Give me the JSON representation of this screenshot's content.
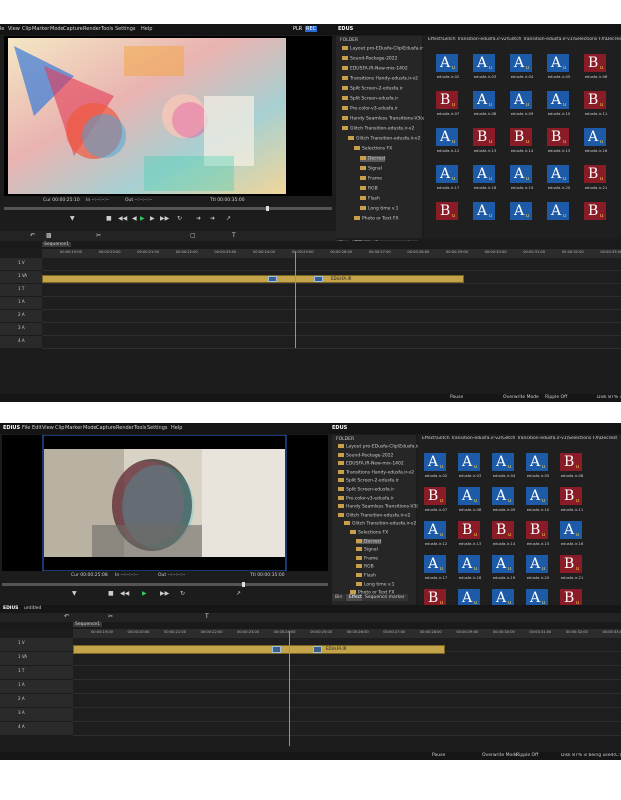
{
  "menu": [
    "File",
    "Edit",
    "View",
    "Clip",
    "Marker",
    "Mode",
    "Capture",
    "Render",
    "Tools",
    "Settings",
    "Help"
  ],
  "app_badge": "EDUS",
  "plr_label": "PLR",
  "rec_label": "REC",
  "monitor": {
    "cur": "Cur 00:00:25:10",
    "in": "In --:--:--:--",
    "out": "Out --:--:--:--",
    "ttl": "Ttl 00:00:35:00",
    "cur2": "Cur 00:00:25:08"
  },
  "bin": {
    "folder_label": "FOLDER",
    "path": "Effect\\Glitch Transition-edusfa.ir-v2\\Glitch Transition-edusfa.ir-v1\\Selections FX\\Decrest",
    "tree": [
      {
        "label": "Layout pro-EDusfa-Clip\\Edusfa.ir",
        "indent": 0
      },
      {
        "label": "Sound-Package-2022",
        "indent": 0
      },
      {
        "label": "EDUSFA.IR-New-mix-1402",
        "indent": 0
      },
      {
        "label": "Transitions Handy-edusfa.ir-v2",
        "indent": 0
      },
      {
        "label": "Split Screen-2-edusfa.ir",
        "indent": 0
      },
      {
        "label": "Split Screen-edusfa.ir",
        "indent": 0
      },
      {
        "label": "Pre-color-v3-edusfa.ir",
        "indent": 0
      },
      {
        "label": "Handy Seamless Transitions-V3(edusfa)",
        "indent": 0
      },
      {
        "label": "Glitch Transition-edusfa.ir-v2",
        "indent": 0
      },
      {
        "label": "Glitch Transition-edusfa.ir-v2",
        "indent": 1
      },
      {
        "label": "Selections FX",
        "indent": 2
      },
      {
        "label": "Decrest",
        "indent": 3,
        "selected": true
      },
      {
        "label": "Signal",
        "indent": 3
      },
      {
        "label": "Frame",
        "indent": 3
      },
      {
        "label": "RGB",
        "indent": 3
      },
      {
        "label": "Flash",
        "indent": 3
      },
      {
        "label": "Long time v.1",
        "indent": 3
      },
      {
        "label": "Photo or Text FX",
        "indent": 2
      }
    ],
    "tiles_top": [
      {
        "g": "A",
        "color": "#1d5aa8",
        "cap": "edusfa.ir-02"
      },
      {
        "g": "A",
        "color": "#1d5aa8",
        "cap": "edusfa.ir-03"
      },
      {
        "g": "A",
        "color": "#1d5aa8",
        "cap": "edusfa.ir-04"
      },
      {
        "g": "A",
        "color": "#1d5aa8",
        "cap": "edusfa.ir-05"
      },
      {
        "g": "B",
        "color": "#8a1c28",
        "cap": "edusfa.ir-06"
      },
      {
        "g": "B",
        "color": "#8a1c28",
        "cap": "edusfa.ir-07"
      },
      {
        "g": "A",
        "color": "#1d5aa8",
        "cap": "edusfa.ir-08"
      },
      {
        "g": "A",
        "color": "#1d5aa8",
        "cap": "edusfa.ir-09"
      },
      {
        "g": "A",
        "color": "#1d5aa8",
        "cap": "edusfa.ir-10"
      },
      {
        "g": "B",
        "color": "#8a1c28",
        "cap": "edusfa.ir-11"
      },
      {
        "g": "A",
        "color": "#1d5aa8",
        "cap": "edusfa.ir-12"
      },
      {
        "g": "B",
        "color": "#8a1c28",
        "cap": "edusfa.ir-13"
      },
      {
        "g": "B",
        "color": "#8a1c28",
        "cap": "edusfa.ir-14"
      },
      {
        "g": "B",
        "color": "#8a1c28",
        "cap": "edusfa.ir-15"
      },
      {
        "g": "A",
        "color": "#1d5aa8",
        "cap": "edusfa.ir-16"
      },
      {
        "g": "A",
        "color": "#1d5aa8",
        "cap": "edusfa.ir-17"
      },
      {
        "g": "A",
        "color": "#1d5aa8",
        "cap": "edusfa.ir-18"
      },
      {
        "g": "A",
        "color": "#1d5aa8",
        "cap": "edusfa.ir-19"
      },
      {
        "g": "A",
        "color": "#1d5aa8",
        "cap": "edusfa.ir-20"
      },
      {
        "g": "B",
        "color": "#8a1c28",
        "cap": "edusfa.ir-21"
      },
      {
        "g": "B",
        "color": "#8a1c28",
        "cap": ""
      },
      {
        "g": "A",
        "color": "#1d5aa8",
        "cap": ""
      },
      {
        "g": "A",
        "color": "#1d5aa8",
        "cap": ""
      },
      {
        "g": "A",
        "color": "#1d5aa8",
        "cap": ""
      },
      {
        "g": "B",
        "color": "#8a1c28",
        "cap": ""
      }
    ],
    "tabs": [
      "Bin",
      "Effect",
      "Sequence marker"
    ],
    "active_tab": "Effect"
  },
  "timeline": {
    "app_label": "EDIUS",
    "project": "untitled",
    "sequence_tab": "Sequence1",
    "ruler": [
      "00:00:19:00",
      "00:00:20:00",
      "00:00:21:00",
      "00:00:22:00",
      "00:00:23:00",
      "00:00:24:00",
      "00:00:25:00",
      "00:00:26:00",
      "00:00:27:00",
      "00:00:28:00",
      "00:00:29:00",
      "00:00:30:00",
      "00:00:31:00",
      "00:00:32:00",
      "00:00:33:00"
    ],
    "tracks": [
      "1 V",
      "1 VA",
      "1 T",
      "1 A",
      "2 A",
      "3 A",
      "4 A"
    ],
    "clip_label": "EDUsFA.IR",
    "status": {
      "state": "Pause",
      "mode": "Overwrite Mode",
      "ripple": "Ripple Off",
      "disk": "Disk 87% is being used(C:)"
    }
  }
}
